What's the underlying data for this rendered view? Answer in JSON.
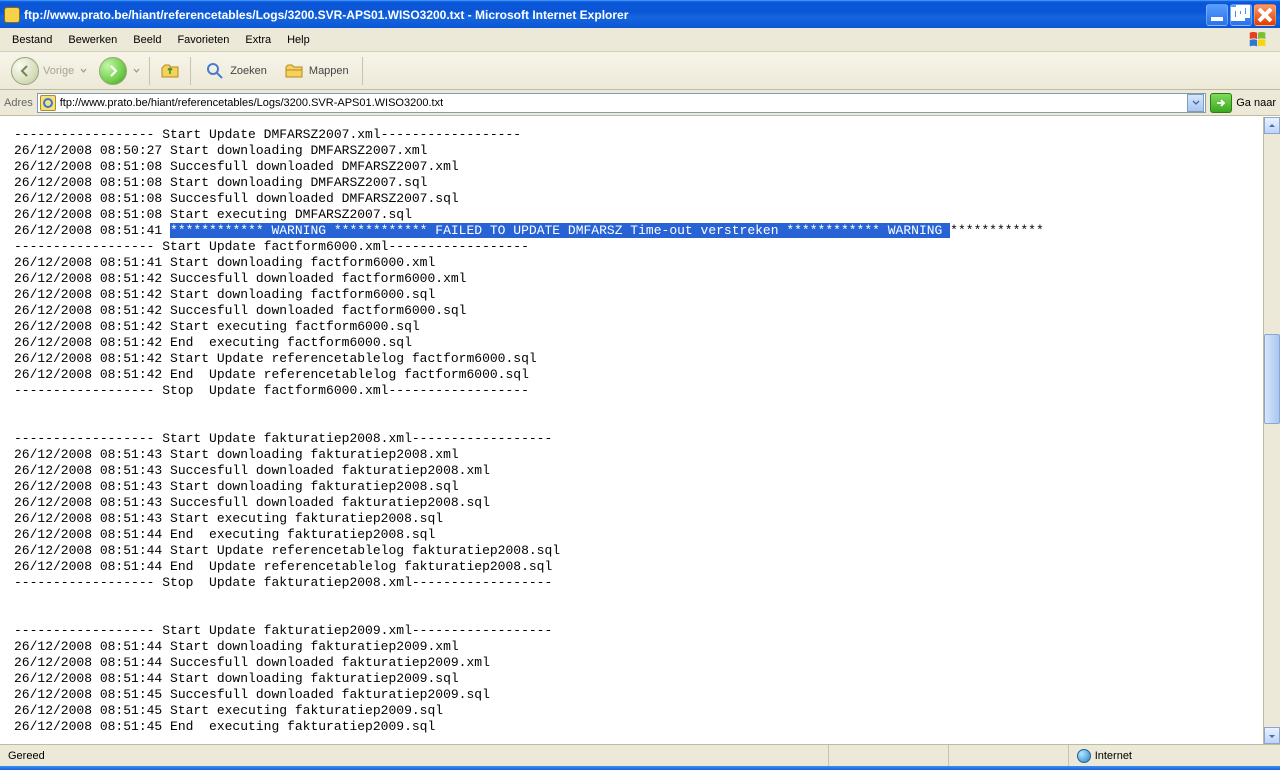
{
  "window": {
    "title": "ftp://www.prato.be/hiant/referencetables/Logs/3200.SVR-APS01.WISO3200.txt - Microsoft Internet Explorer"
  },
  "menu": {
    "bestand": "Bestand",
    "bewerken": "Bewerken",
    "beeld": "Beeld",
    "favorieten": "Favorieten",
    "extra": "Extra",
    "help": "Help"
  },
  "toolbar": {
    "back": "Vorige",
    "search": "Zoeken",
    "folders": "Mappen"
  },
  "address": {
    "label": "Adres",
    "url": "ftp://www.prato.be/hiant/referencetables/Logs/3200.SVR-APS01.WISO3200.txt",
    "go": "Ga naar"
  },
  "log": {
    "lines": [
      "------------------ Start Update DMFARSZ2007.xml------------------",
      "26/12/2008 08:50:27 Start downloading DMFARSZ2007.xml",
      "26/12/2008 08:51:08 Succesfull downloaded DMFARSZ2007.xml",
      "26/12/2008 08:51:08 Start downloading DMFARSZ2007.sql",
      "26/12/2008 08:51:08 Succesfull downloaded DMFARSZ2007.sql",
      "26/12/2008 08:51:08 Start executing DMFARSZ2007.sql"
    ],
    "warn_prefix": "26/12/2008 08:51:41 ",
    "warn_hl": "************ WARNING ************ FAILED TO UPDATE DMFARSZ Time-out verstreken ************ WARNING ",
    "warn_suffix": "************",
    "lines2": [
      "------------------ Start Update factform6000.xml------------------",
      "26/12/2008 08:51:41 Start downloading factform6000.xml",
      "26/12/2008 08:51:42 Succesfull downloaded factform6000.xml",
      "26/12/2008 08:51:42 Start downloading factform6000.sql",
      "26/12/2008 08:51:42 Succesfull downloaded factform6000.sql",
      "26/12/2008 08:51:42 Start executing factform6000.sql",
      "26/12/2008 08:51:42 End  executing factform6000.sql",
      "26/12/2008 08:51:42 Start Update referencetablelog factform6000.sql",
      "26/12/2008 08:51:42 End  Update referencetablelog factform6000.sql",
      "------------------ Stop  Update factform6000.xml------------------",
      "",
      "",
      "------------------ Start Update fakturatiep2008.xml------------------",
      "26/12/2008 08:51:43 Start downloading fakturatiep2008.xml",
      "26/12/2008 08:51:43 Succesfull downloaded fakturatiep2008.xml",
      "26/12/2008 08:51:43 Start downloading fakturatiep2008.sql",
      "26/12/2008 08:51:43 Succesfull downloaded fakturatiep2008.sql",
      "26/12/2008 08:51:43 Start executing fakturatiep2008.sql",
      "26/12/2008 08:51:44 End  executing fakturatiep2008.sql",
      "26/12/2008 08:51:44 Start Update referencetablelog fakturatiep2008.sql",
      "26/12/2008 08:51:44 End  Update referencetablelog fakturatiep2008.sql",
      "------------------ Stop  Update fakturatiep2008.xml------------------",
      "",
      "",
      "------------------ Start Update fakturatiep2009.xml------------------",
      "26/12/2008 08:51:44 Start downloading fakturatiep2009.xml",
      "26/12/2008 08:51:44 Succesfull downloaded fakturatiep2009.xml",
      "26/12/2008 08:51:44 Start downloading fakturatiep2009.sql",
      "26/12/2008 08:51:45 Succesfull downloaded fakturatiep2009.sql",
      "26/12/2008 08:51:45 Start executing fakturatiep2009.sql",
      "26/12/2008 08:51:45 End  executing fakturatiep2009.sql"
    ]
  },
  "status": {
    "ready": "Gereed",
    "zone": "Internet"
  }
}
